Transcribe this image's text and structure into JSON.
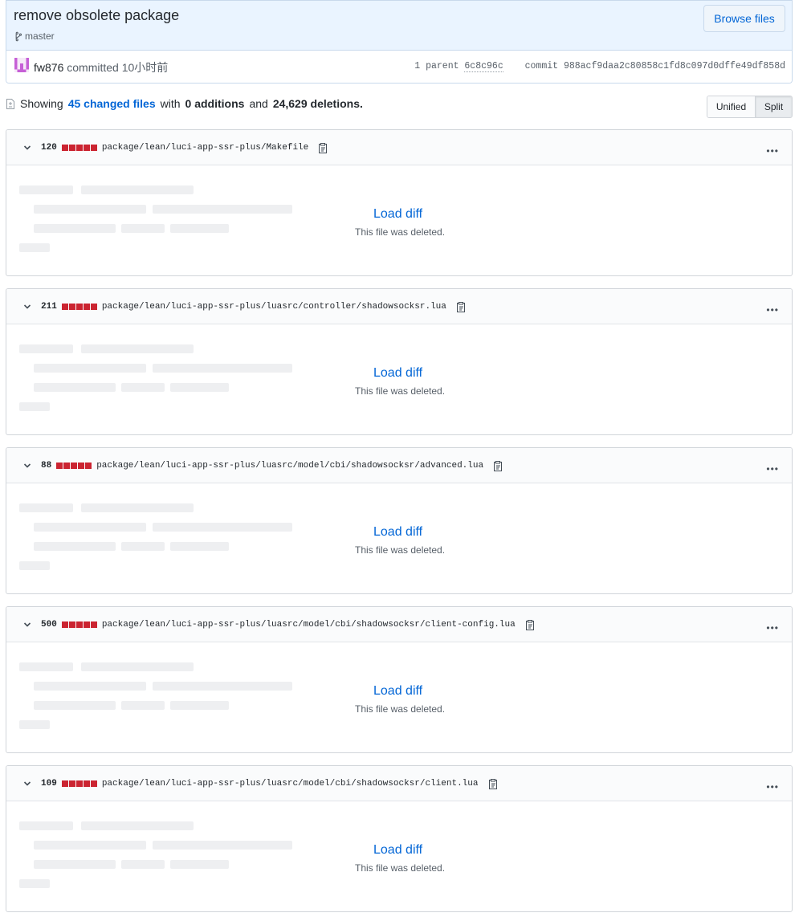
{
  "commit": {
    "title": "remove obsolete package",
    "branch": "master",
    "browse_label": "Browse files",
    "author": "fw876",
    "action": "committed",
    "time": "10小时前",
    "parent_label": "1 parent",
    "parent_sha": "6c8c96c",
    "commit_label": "commit",
    "commit_sha": "988acf9daa2c80858c1fd8c097d0dffe49df858d"
  },
  "summary": {
    "showing": "Showing",
    "changed_files": "45 changed files",
    "with": "with",
    "additions": "0 additions",
    "and": "and",
    "deletions": "24,629 deletions."
  },
  "view_toggle": {
    "unified": "Unified",
    "split": "Split",
    "selected": "Split"
  },
  "files": [
    {
      "count": "120",
      "path": "package/lean/luci-app-ssr-plus/Makefile",
      "load": "Load diff",
      "note": "This file was deleted."
    },
    {
      "count": "211",
      "path": "package/lean/luci-app-ssr-plus/luasrc/controller/shadowsocksr.lua",
      "load": "Load diff",
      "note": "This file was deleted."
    },
    {
      "count": "88",
      "path": "package/lean/luci-app-ssr-plus/luasrc/model/cbi/shadowsocksr/advanced.lua",
      "load": "Load diff",
      "note": "This file was deleted."
    },
    {
      "count": "500",
      "path": "package/lean/luci-app-ssr-plus/luasrc/model/cbi/shadowsocksr/client-config.lua",
      "load": "Load diff",
      "note": "This file was deleted."
    },
    {
      "count": "109",
      "path": "package/lean/luci-app-ssr-plus/luasrc/model/cbi/shadowsocksr/client.lua",
      "load": "Load diff",
      "note": "This file was deleted."
    }
  ],
  "colors": {
    "accent": "#0366d6",
    "deletion": "#cb2431",
    "header_bg": "#eaf4ff"
  },
  "icons": [
    "git-branch-icon",
    "avatar-identicon",
    "file-diff-icon",
    "chevron-down-icon",
    "clipboard-icon",
    "kebab-horizontal-icon"
  ]
}
